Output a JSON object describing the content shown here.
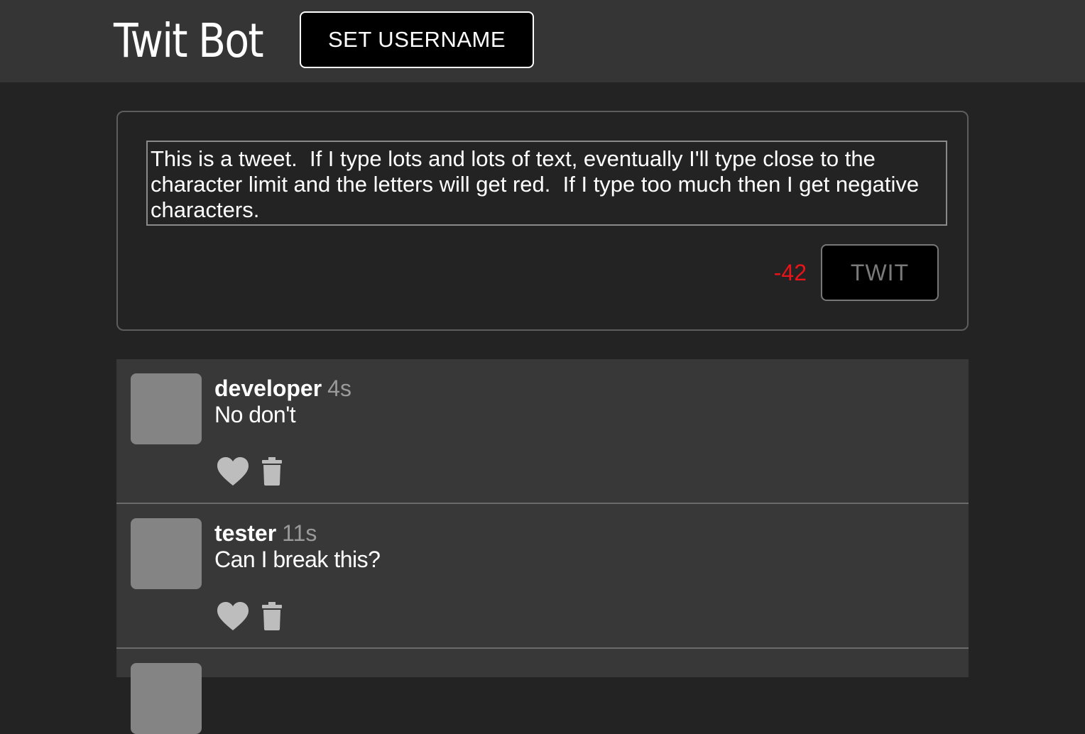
{
  "header": {
    "title": "Twit Bot",
    "set_username_label": "SET USERNAME"
  },
  "composer": {
    "text": "This is a tweet.  If I type lots and lots of text, eventually I'll type close to the character limit and the letters will get red.  If I type too much then I get negative characters.",
    "char_count": "-42",
    "char_count_color": "#e8141a",
    "submit_label": "TWIT"
  },
  "feed": {
    "tweets": [
      {
        "username": "developer",
        "time": "4s",
        "text": "No don't",
        "actions": [
          "heart-icon",
          "trash-icon"
        ]
      },
      {
        "username": "tester",
        "time": "11s",
        "text": "Can I break this?",
        "actions": [
          "heart-icon",
          "trash-icon"
        ]
      }
    ]
  },
  "colors": {
    "background": "#232323",
    "header": "#353535",
    "tweet_card": "#383838",
    "avatar": "#848484",
    "icon": "#bdbdbd"
  }
}
